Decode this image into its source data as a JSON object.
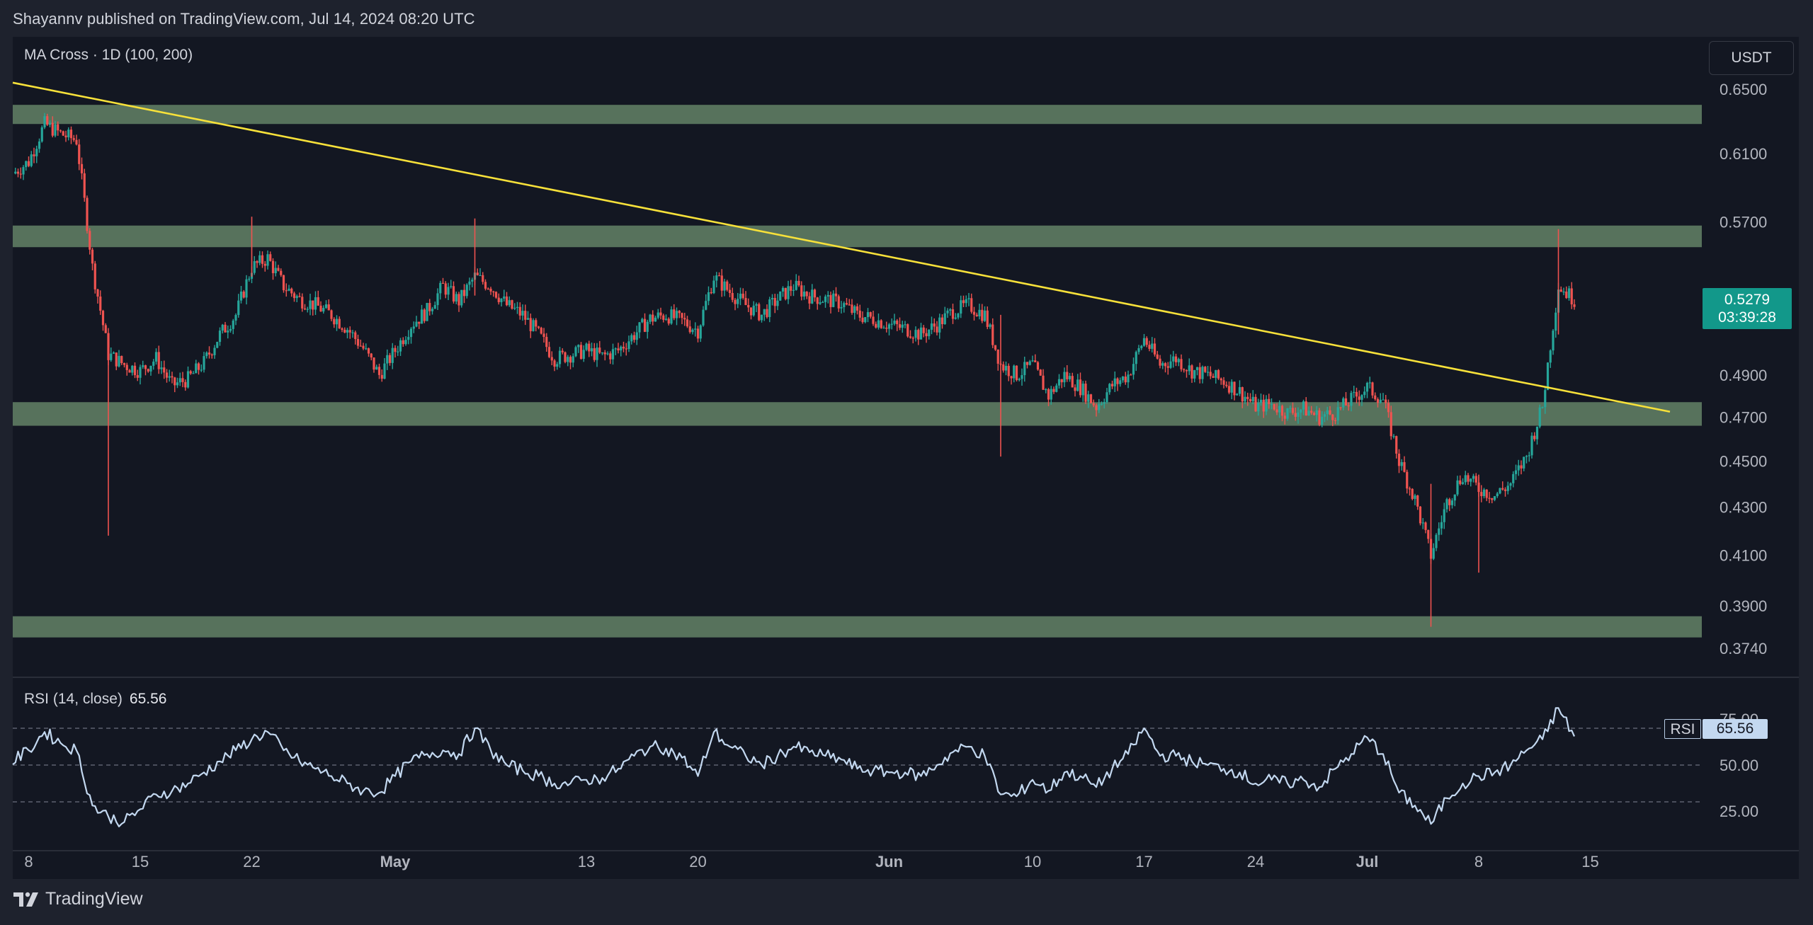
{
  "header": {
    "publisher_text": "Shayannv published on TradingView.com, Jul 14, 2024 08:20 UTC"
  },
  "main_panel": {
    "indicator_title": "MA Cross · 1D (100, 200)",
    "currency_button": "USDT",
    "last_price": "0.5279",
    "countdown": "03:39:28"
  },
  "rsi_panel": {
    "title": "RSI (14, close)",
    "value": "65.56",
    "tag_name": "RSI",
    "tag_value": "65.56"
  },
  "footer": {
    "brand": "TradingView"
  },
  "colors": {
    "up": "#26a69a",
    "down": "#ef5350",
    "zone": "#5b7760",
    "trendline": "#f7e13a",
    "rsi_line": "#c3d8f0",
    "price_tag": "#12988a"
  },
  "chart_data": [
    {
      "type": "candlestick",
      "title": "MA Cross · 1D (100, 200)",
      "y_axis_ticks": [
        "0.6500",
        "0.6100",
        "0.5700",
        "0.4900",
        "0.4700",
        "0.4500",
        "0.4300",
        "0.4100",
        "0.3900",
        "0.3740"
      ],
      "x_axis_ticks": [
        {
          "label": "8",
          "date": "2024-04-08",
          "bold": false
        },
        {
          "label": "15",
          "date": "2024-04-15",
          "bold": false
        },
        {
          "label": "22",
          "date": "2024-04-22",
          "bold": false
        },
        {
          "label": "May",
          "date": "2024-05-01",
          "bold": true
        },
        {
          "label": "13",
          "date": "2024-05-13",
          "bold": false
        },
        {
          "label": "20",
          "date": "2024-05-20",
          "bold": false
        },
        {
          "label": "Jun",
          "date": "2024-06-01",
          "bold": true
        },
        {
          "label": "10",
          "date": "2024-06-10",
          "bold": false
        },
        {
          "label": "17",
          "date": "2024-06-17",
          "bold": false
        },
        {
          "label": "24",
          "date": "2024-06-24",
          "bold": false
        },
        {
          "label": "Jul",
          "date": "2024-07-01",
          "bold": true
        },
        {
          "label": "8",
          "date": "2024-07-08",
          "bold": false
        },
        {
          "label": "15",
          "date": "2024-07-15",
          "bold": false
        }
      ],
      "x_range": [
        "2024-04-07",
        "2024-07-22"
      ],
      "support_resistance_zones": [
        {
          "low": 0.628,
          "high": 0.64
        },
        {
          "low": 0.556,
          "high": 0.568
        },
        {
          "low": 0.466,
          "high": 0.477
        },
        {
          "low": 0.378,
          "high": 0.386
        }
      ],
      "trendline": {
        "start": {
          "date": "2024-04-07",
          "price": 0.6542
        },
        "end": {
          "date": "2024-07-20",
          "price": 0.4725
        }
      },
      "price_path": [
        [
          "2024-04-07",
          0.598
        ],
        [
          "2024-04-08",
          0.605
        ],
        [
          "2024-04-09",
          0.628
        ],
        [
          "2024-04-10",
          0.622
        ],
        [
          "2024-04-11",
          0.618
        ],
        [
          "2024-04-12",
          0.545
        ],
        [
          "2024-04-13",
          0.5
        ],
        [
          "2024-04-14",
          0.495
        ],
        [
          "2024-04-15",
          0.492
        ],
        [
          "2024-04-16",
          0.498
        ],
        [
          "2024-04-17",
          0.485
        ],
        [
          "2024-04-18",
          0.488
        ],
        [
          "2024-04-19",
          0.496
        ],
        [
          "2024-04-20",
          0.51
        ],
        [
          "2024-04-21",
          0.52
        ],
        [
          "2024-04-22",
          0.545
        ],
        [
          "2024-04-23",
          0.55
        ],
        [
          "2024-04-24",
          0.535
        ],
        [
          "2024-04-25",
          0.528
        ],
        [
          "2024-04-26",
          0.525
        ],
        [
          "2024-04-27",
          0.52
        ],
        [
          "2024-04-28",
          0.513
        ],
        [
          "2024-04-29",
          0.503
        ],
        [
          "2024-04-30",
          0.49
        ],
        [
          "2024-05-01",
          0.502
        ],
        [
          "2024-05-02",
          0.515
        ],
        [
          "2024-05-03",
          0.522
        ],
        [
          "2024-05-04",
          0.535
        ],
        [
          "2024-05-05",
          0.527
        ],
        [
          "2024-05-06",
          0.54
        ],
        [
          "2024-05-07",
          0.535
        ],
        [
          "2024-05-08",
          0.525
        ],
        [
          "2024-05-09",
          0.52
        ],
        [
          "2024-05-10",
          0.51
        ],
        [
          "2024-05-11",
          0.498
        ],
        [
          "2024-05-12",
          0.5
        ],
        [
          "2024-05-13",
          0.502
        ],
        [
          "2024-05-14",
          0.499
        ],
        [
          "2024-05-15",
          0.502
        ],
        [
          "2024-05-16",
          0.51
        ],
        [
          "2024-05-17",
          0.518
        ],
        [
          "2024-05-18",
          0.52
        ],
        [
          "2024-05-19",
          0.517
        ],
        [
          "2024-05-20",
          0.512
        ],
        [
          "2024-05-21",
          0.54
        ],
        [
          "2024-05-22",
          0.532
        ],
        [
          "2024-05-23",
          0.525
        ],
        [
          "2024-05-24",
          0.52
        ],
        [
          "2024-05-25",
          0.528
        ],
        [
          "2024-05-26",
          0.535
        ],
        [
          "2024-05-27",
          0.53
        ],
        [
          "2024-05-28",
          0.528
        ],
        [
          "2024-05-29",
          0.526
        ],
        [
          "2024-05-30",
          0.52
        ],
        [
          "2024-05-31",
          0.518
        ],
        [
          "2024-06-01",
          0.515
        ],
        [
          "2024-06-02",
          0.513
        ],
        [
          "2024-06-03",
          0.51
        ],
        [
          "2024-06-04",
          0.515
        ],
        [
          "2024-06-05",
          0.522
        ],
        [
          "2024-06-06",
          0.525
        ],
        [
          "2024-06-07",
          0.52
        ],
        [
          "2024-06-08",
          0.495
        ],
        [
          "2024-06-09",
          0.49
        ],
        [
          "2024-06-10",
          0.495
        ],
        [
          "2024-06-11",
          0.48
        ],
        [
          "2024-06-12",
          0.49
        ],
        [
          "2024-06-13",
          0.484
        ],
        [
          "2024-06-14",
          0.475
        ],
        [
          "2024-06-15",
          0.485
        ],
        [
          "2024-06-16",
          0.49
        ],
        [
          "2024-06-17",
          0.508
        ],
        [
          "2024-06-18",
          0.495
        ],
        [
          "2024-06-19",
          0.498
        ],
        [
          "2024-06-20",
          0.492
        ],
        [
          "2024-06-21",
          0.49
        ],
        [
          "2024-06-22",
          0.487
        ],
        [
          "2024-06-23",
          0.482
        ],
        [
          "2024-06-24",
          0.475
        ],
        [
          "2024-06-25",
          0.476
        ],
        [
          "2024-06-26",
          0.472
        ],
        [
          "2024-06-27",
          0.474
        ],
        [
          "2024-06-28",
          0.47
        ],
        [
          "2024-06-29",
          0.472
        ],
        [
          "2024-06-30",
          0.478
        ],
        [
          "2024-07-01",
          0.484
        ],
        [
          "2024-07-02",
          0.478
        ],
        [
          "2024-07-03",
          0.45
        ],
        [
          "2024-07-04",
          0.433
        ],
        [
          "2024-07-05",
          0.41
        ],
        [
          "2024-07-06",
          0.432
        ],
        [
          "2024-07-07",
          0.444
        ],
        [
          "2024-07-08",
          0.438
        ],
        [
          "2024-07-09",
          0.435
        ],
        [
          "2024-07-10",
          0.44
        ],
        [
          "2024-07-11",
          0.452
        ],
        [
          "2024-07-12",
          0.475
        ],
        [
          "2024-07-13",
          0.535
        ],
        [
          "2024-07-14",
          0.528
        ]
      ]
    },
    {
      "type": "line",
      "title": "RSI (14, close)",
      "y_axis_ticks": [
        "75.00",
        "50.00",
        "25.00"
      ],
      "y_range": [
        10,
        85
      ],
      "dashed_levels": [
        70,
        50,
        30
      ],
      "series": [
        {
          "name": "RSI",
          "points": [
            [
              "2024-04-07",
              52
            ],
            [
              "2024-04-08",
              58
            ],
            [
              "2024-04-09",
              68
            ],
            [
              "2024-04-10",
              62
            ],
            [
              "2024-04-11",
              58
            ],
            [
              "2024-04-12",
              28
            ],
            [
              "2024-04-13",
              22
            ],
            [
              "2024-04-14",
              19
            ],
            [
              "2024-04-15",
              26
            ],
            [
              "2024-04-16",
              34
            ],
            [
              "2024-04-17",
              36
            ],
            [
              "2024-04-18",
              40
            ],
            [
              "2024-04-19",
              46
            ],
            [
              "2024-04-20",
              52
            ],
            [
              "2024-04-21",
              58
            ],
            [
              "2024-04-22",
              64
            ],
            [
              "2024-04-23",
              68
            ],
            [
              "2024-04-24",
              58
            ],
            [
              "2024-04-25",
              52
            ],
            [
              "2024-04-26",
              48
            ],
            [
              "2024-04-27",
              44
            ],
            [
              "2024-04-28",
              40
            ],
            [
              "2024-04-29",
              36
            ],
            [
              "2024-04-30",
              35
            ],
            [
              "2024-05-01",
              44
            ],
            [
              "2024-05-02",
              52
            ],
            [
              "2024-05-03",
              56
            ],
            [
              "2024-05-04",
              58
            ],
            [
              "2024-05-05",
              56
            ],
            [
              "2024-05-06",
              70
            ],
            [
              "2024-05-07",
              58
            ],
            [
              "2024-05-08",
              50
            ],
            [
              "2024-05-09",
              47
            ],
            [
              "2024-05-10",
              44
            ],
            [
              "2024-05-11",
              40
            ],
            [
              "2024-05-12",
              40
            ],
            [
              "2024-05-13",
              42
            ],
            [
              "2024-05-14",
              43
            ],
            [
              "2024-05-15",
              48
            ],
            [
              "2024-05-16",
              55
            ],
            [
              "2024-05-17",
              60
            ],
            [
              "2024-05-18",
              59
            ],
            [
              "2024-05-19",
              54
            ],
            [
              "2024-05-20",
              44
            ],
            [
              "2024-05-21",
              68
            ],
            [
              "2024-05-22",
              60
            ],
            [
              "2024-05-23",
              55
            ],
            [
              "2024-05-24",
              50
            ],
            [
              "2024-05-25",
              55
            ],
            [
              "2024-05-26",
              60
            ],
            [
              "2024-05-27",
              57
            ],
            [
              "2024-05-28",
              55
            ],
            [
              "2024-05-29",
              53
            ],
            [
              "2024-05-30",
              48
            ],
            [
              "2024-05-31",
              47
            ],
            [
              "2024-06-01",
              46
            ],
            [
              "2024-06-02",
              46
            ],
            [
              "2024-06-03",
              44
            ],
            [
              "2024-06-04",
              50
            ],
            [
              "2024-06-05",
              57
            ],
            [
              "2024-06-06",
              60
            ],
            [
              "2024-06-07",
              55
            ],
            [
              "2024-06-08",
              34
            ],
            [
              "2024-06-09",
              33
            ],
            [
              "2024-06-10",
              42
            ],
            [
              "2024-06-11",
              36
            ],
            [
              "2024-06-12",
              46
            ],
            [
              "2024-06-13",
              44
            ],
            [
              "2024-06-14",
              38
            ],
            [
              "2024-06-15",
              48
            ],
            [
              "2024-06-16",
              56
            ],
            [
              "2024-06-17",
              70
            ],
            [
              "2024-06-18",
              55
            ],
            [
              "2024-06-19",
              55
            ],
            [
              "2024-06-20",
              52
            ],
            [
              "2024-06-21",
              50
            ],
            [
              "2024-06-22",
              48
            ],
            [
              "2024-06-23",
              46
            ],
            [
              "2024-06-24",
              40
            ],
            [
              "2024-06-25",
              42
            ],
            [
              "2024-06-26",
              40
            ],
            [
              "2024-06-27",
              42
            ],
            [
              "2024-06-28",
              38
            ],
            [
              "2024-06-29",
              48
            ],
            [
              "2024-06-30",
              56
            ],
            [
              "2024-07-01",
              65
            ],
            [
              "2024-07-02",
              56
            ],
            [
              "2024-07-03",
              35
            ],
            [
              "2024-07-04",
              28
            ],
            [
              "2024-07-05",
              18
            ],
            [
              "2024-07-06",
              32
            ],
            [
              "2024-07-07",
              40
            ],
            [
              "2024-07-08",
              44
            ],
            [
              "2024-07-09",
              46
            ],
            [
              "2024-07-10",
              50
            ],
            [
              "2024-07-11",
              58
            ],
            [
              "2024-07-12",
              64
            ],
            [
              "2024-07-13",
              81
            ],
            [
              "2024-07-14",
              65.56
            ]
          ]
        }
      ]
    }
  ]
}
